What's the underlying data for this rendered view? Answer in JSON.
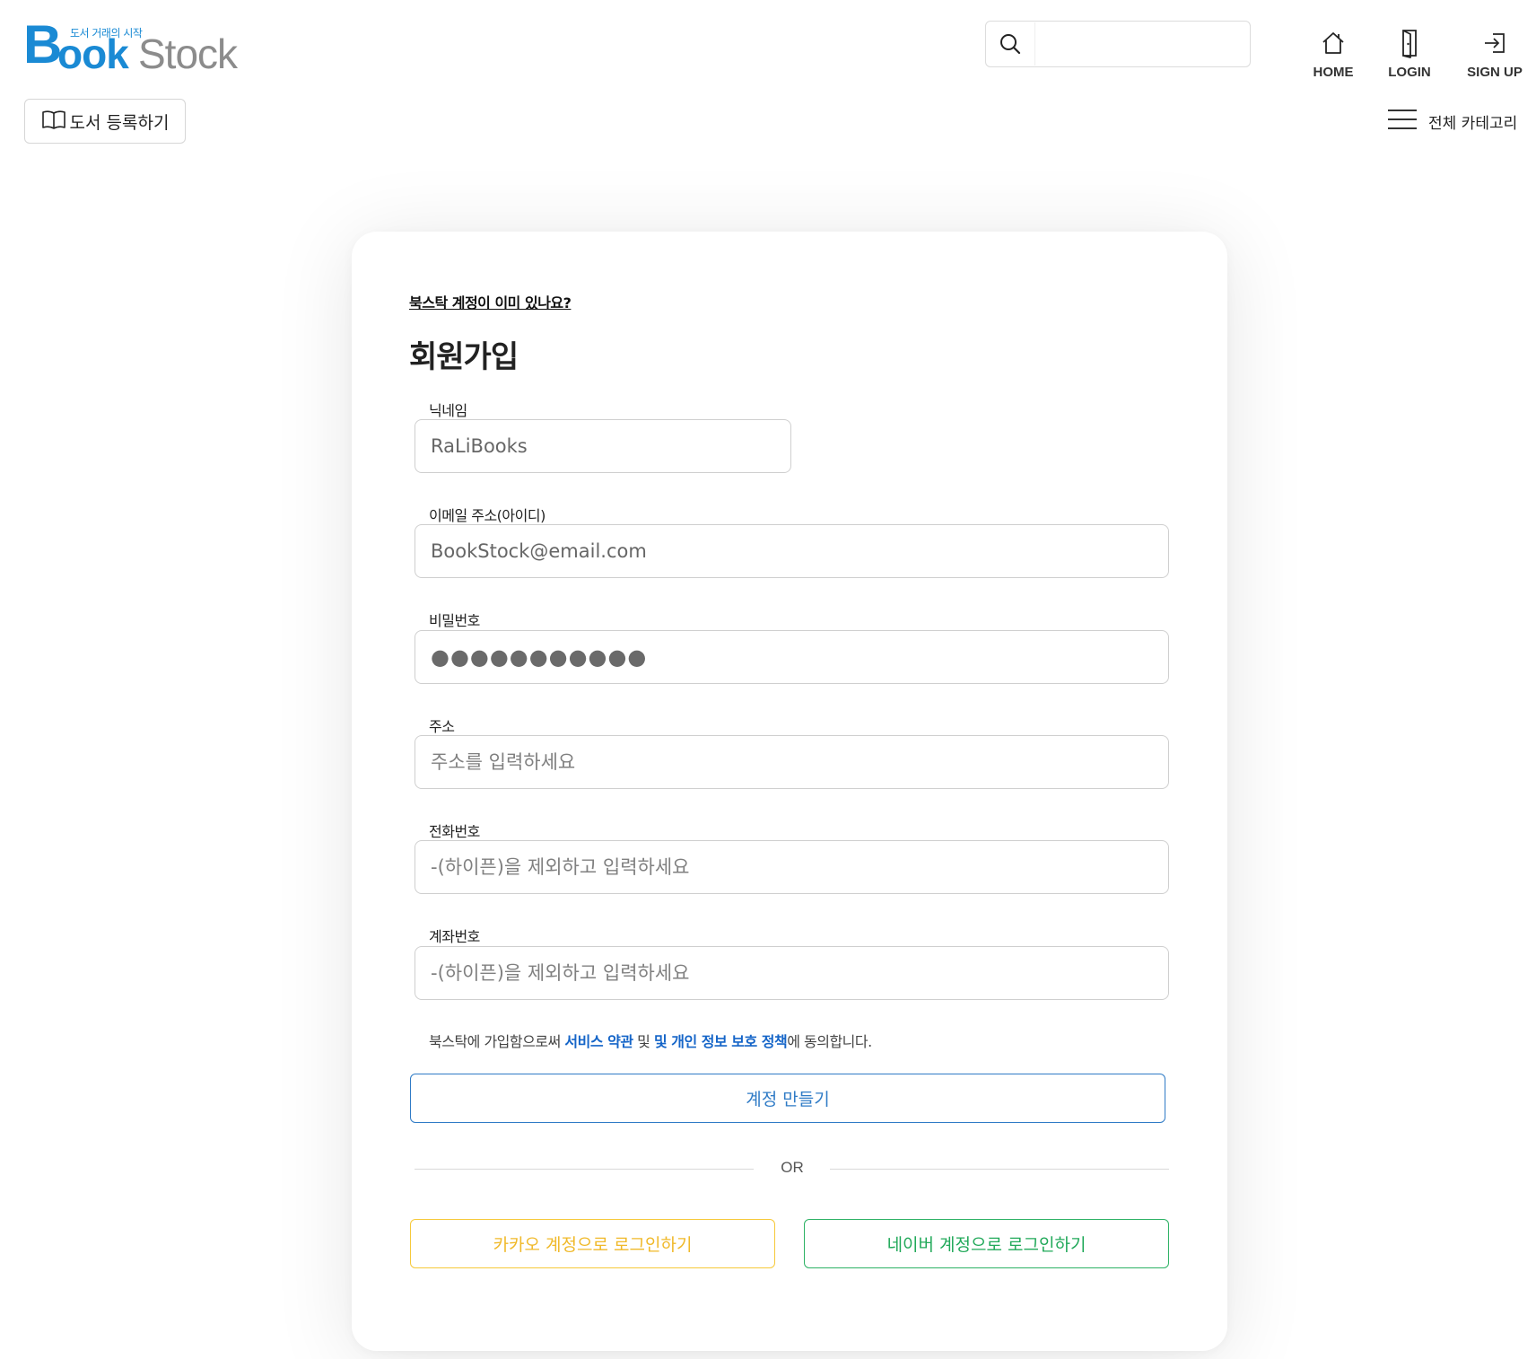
{
  "header": {
    "logo": {
      "tagline": "도서 거래의 시작",
      "part_b": "B",
      "part_ook": "ook",
      "part_stock": "Stock"
    },
    "search": {
      "placeholder": "",
      "value": ""
    },
    "nav": [
      {
        "label": "HOME",
        "icon": "home-icon"
      },
      {
        "label": "LOGIN",
        "icon": "door-icon"
      },
      {
        "label": "SIGN UP",
        "icon": "sign-in-icon"
      }
    ],
    "register_button": {
      "label": "도서 등록하기",
      "icon": "open-book-icon"
    },
    "category_button": {
      "label": "전체 카테고리",
      "icon": "hamburger-menu-icon"
    }
  },
  "form": {
    "have_account_link": "북스탁 계정이 이미 있나요?",
    "title": "회원가입",
    "fields": {
      "nickname": {
        "label": "닉네임",
        "value": "RaLiBooks"
      },
      "email": {
        "label": "이메일 주소(아이디)",
        "value": "BookStock@email.com"
      },
      "password": {
        "label": "비밀번호",
        "value": "●●●●●●●●●●●"
      },
      "address": {
        "label": "주소",
        "placeholder": "주소를 입력하세요"
      },
      "phone": {
        "label": "전화번호",
        "placeholder": "-(하이픈)을 제외하고 입력하세요"
      },
      "account": {
        "label": "계좌번호",
        "placeholder": "-(하이픈)을 제외하고 입력하세요"
      }
    },
    "agreement": {
      "prefix": "북스탁에 가입함으로써 ",
      "terms_link": "서비스 약관",
      "middle": " 및 ",
      "privacy_link": "및 개인 정보 보호 정책",
      "suffix": "에 동의합니다."
    },
    "create_button": "계정 만들기",
    "or_text": "OR",
    "kakao_button": "카카오 계정으로 로그인하기",
    "naver_button": "네이버 계정으로 로그인하기"
  },
  "colors": {
    "brand_blue": "#1a8ad4",
    "brand_gray": "#8c8c8c",
    "link_blue": "#1565c8",
    "create_button": "#2f7bc6",
    "kakao": "#f6c93a",
    "naver": "#2db265"
  }
}
